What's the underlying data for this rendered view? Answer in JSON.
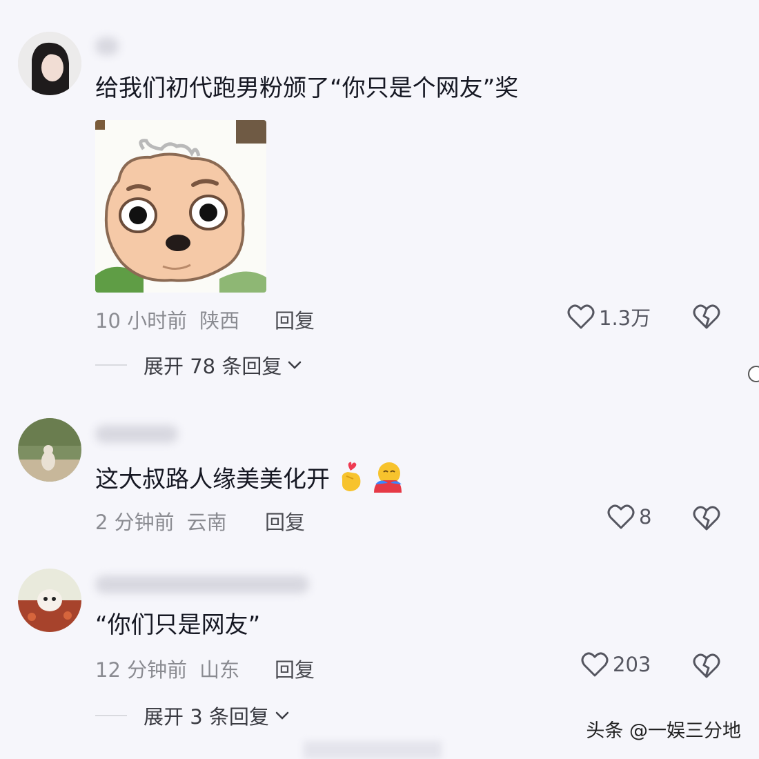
{
  "comments": [
    {
      "text": "给我们初代跑男粉颁了“你只是个网友”奖",
      "time": "10 小时前",
      "region": "陕西",
      "reply_label": "回复",
      "likes": "1.3万",
      "expand_label": "展开 78 条回复",
      "has_sticker": true
    },
    {
      "text": "这大叔路人缘美美化开",
      "time": "2 分钟前",
      "region": "云南",
      "reply_label": "回复",
      "likes": "8"
    },
    {
      "text": "“你们只是网友”",
      "time": "12 分钟前",
      "region": "山东",
      "reply_label": "回复",
      "likes": "203",
      "expand_label": "展开 3 条回复"
    }
  ],
  "watermark": "头条 @一娱三分地",
  "colors": {
    "background": "#f6f6fb",
    "text": "#161823",
    "meta": "#8a8b91"
  },
  "icons": {
    "like": "heart-outline-icon",
    "dislike": "broken-heart-icon",
    "expand": "chevron-down-icon"
  }
}
